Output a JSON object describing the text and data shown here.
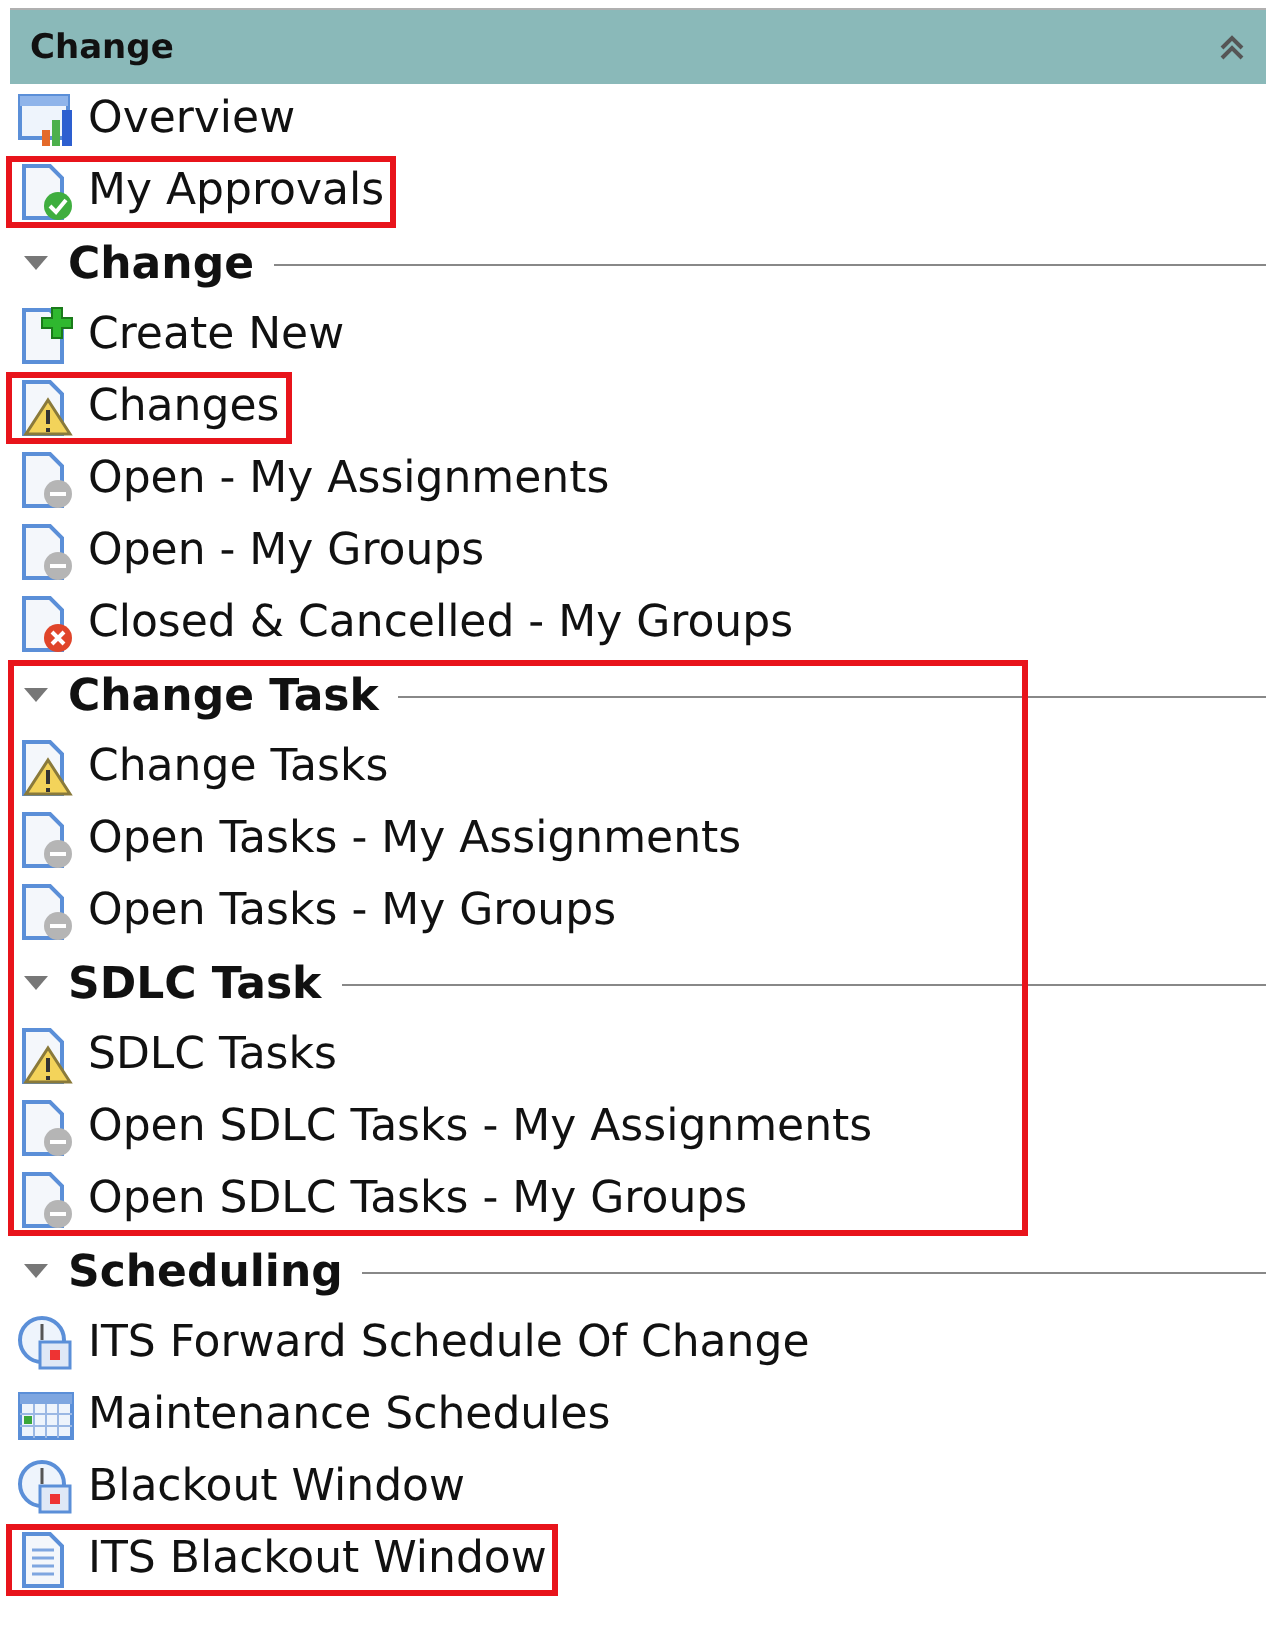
{
  "panel": {
    "title": "Change"
  },
  "items": [
    {
      "label": "Overview",
      "kind": "chart",
      "highlighted": false
    },
    {
      "label": "My Approvals",
      "kind": "approved",
      "highlighted": true
    }
  ],
  "sections": [
    {
      "title": "Change",
      "highlighted": false,
      "items": [
        {
          "label": "Create New",
          "kind": "add",
          "highlighted": false
        },
        {
          "label": "Changes",
          "kind": "warning",
          "highlighted": true
        },
        {
          "label": "Open - My Assignments",
          "kind": "open",
          "highlighted": false
        },
        {
          "label": "Open - My Groups",
          "kind": "open",
          "highlighted": false
        },
        {
          "label": "Closed & Cancelled - My Groups",
          "kind": "closed",
          "highlighted": false
        }
      ]
    },
    {
      "title": "Change Task",
      "highlighted": true,
      "items": [
        {
          "label": "Change Tasks",
          "kind": "warning",
          "highlighted": false
        },
        {
          "label": "Open Tasks - My Assignments",
          "kind": "open",
          "highlighted": false
        },
        {
          "label": "Open Tasks - My Groups",
          "kind": "open",
          "highlighted": false
        }
      ]
    },
    {
      "title": "SDLC Task",
      "highlighted": true,
      "items": [
        {
          "label": "SDLC Tasks",
          "kind": "warning",
          "highlighted": false
        },
        {
          "label": "Open SDLC Tasks - My Assignments",
          "kind": "open",
          "highlighted": false
        },
        {
          "label": "Open SDLC Tasks - My Groups",
          "kind": "open",
          "highlighted": false
        }
      ]
    },
    {
      "title": "Scheduling",
      "highlighted": false,
      "items": [
        {
          "label": "ITS Forward Schedule Of Change",
          "kind": "clock",
          "highlighted": false
        },
        {
          "label": "Maintenance Schedules",
          "kind": "calendar",
          "highlighted": false
        },
        {
          "label": "Blackout Window",
          "kind": "clock",
          "highlighted": false
        },
        {
          "label": "ITS Blackout Window",
          "kind": "document",
          "highlighted": true
        }
      ]
    }
  ]
}
